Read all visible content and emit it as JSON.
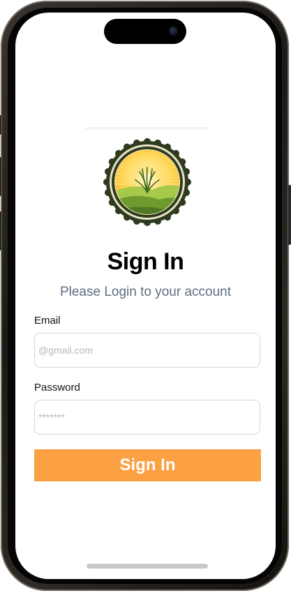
{
  "signin": {
    "title": "Sign In",
    "subtitle": "Please Login to your account",
    "email_label": "Email",
    "email_placeholder": "@gmail.com",
    "password_label": "Password",
    "password_placeholder": "*******",
    "button_label": "Sign In"
  },
  "colors": {
    "accent": "#fca044",
    "subtitle": "#5f6e80",
    "logo_ring": "#2f3b1e",
    "logo_sun": "#f6b823",
    "logo_hill": "#8fb83a"
  },
  "icons": {
    "logo": "sun-grass-badge-icon"
  }
}
